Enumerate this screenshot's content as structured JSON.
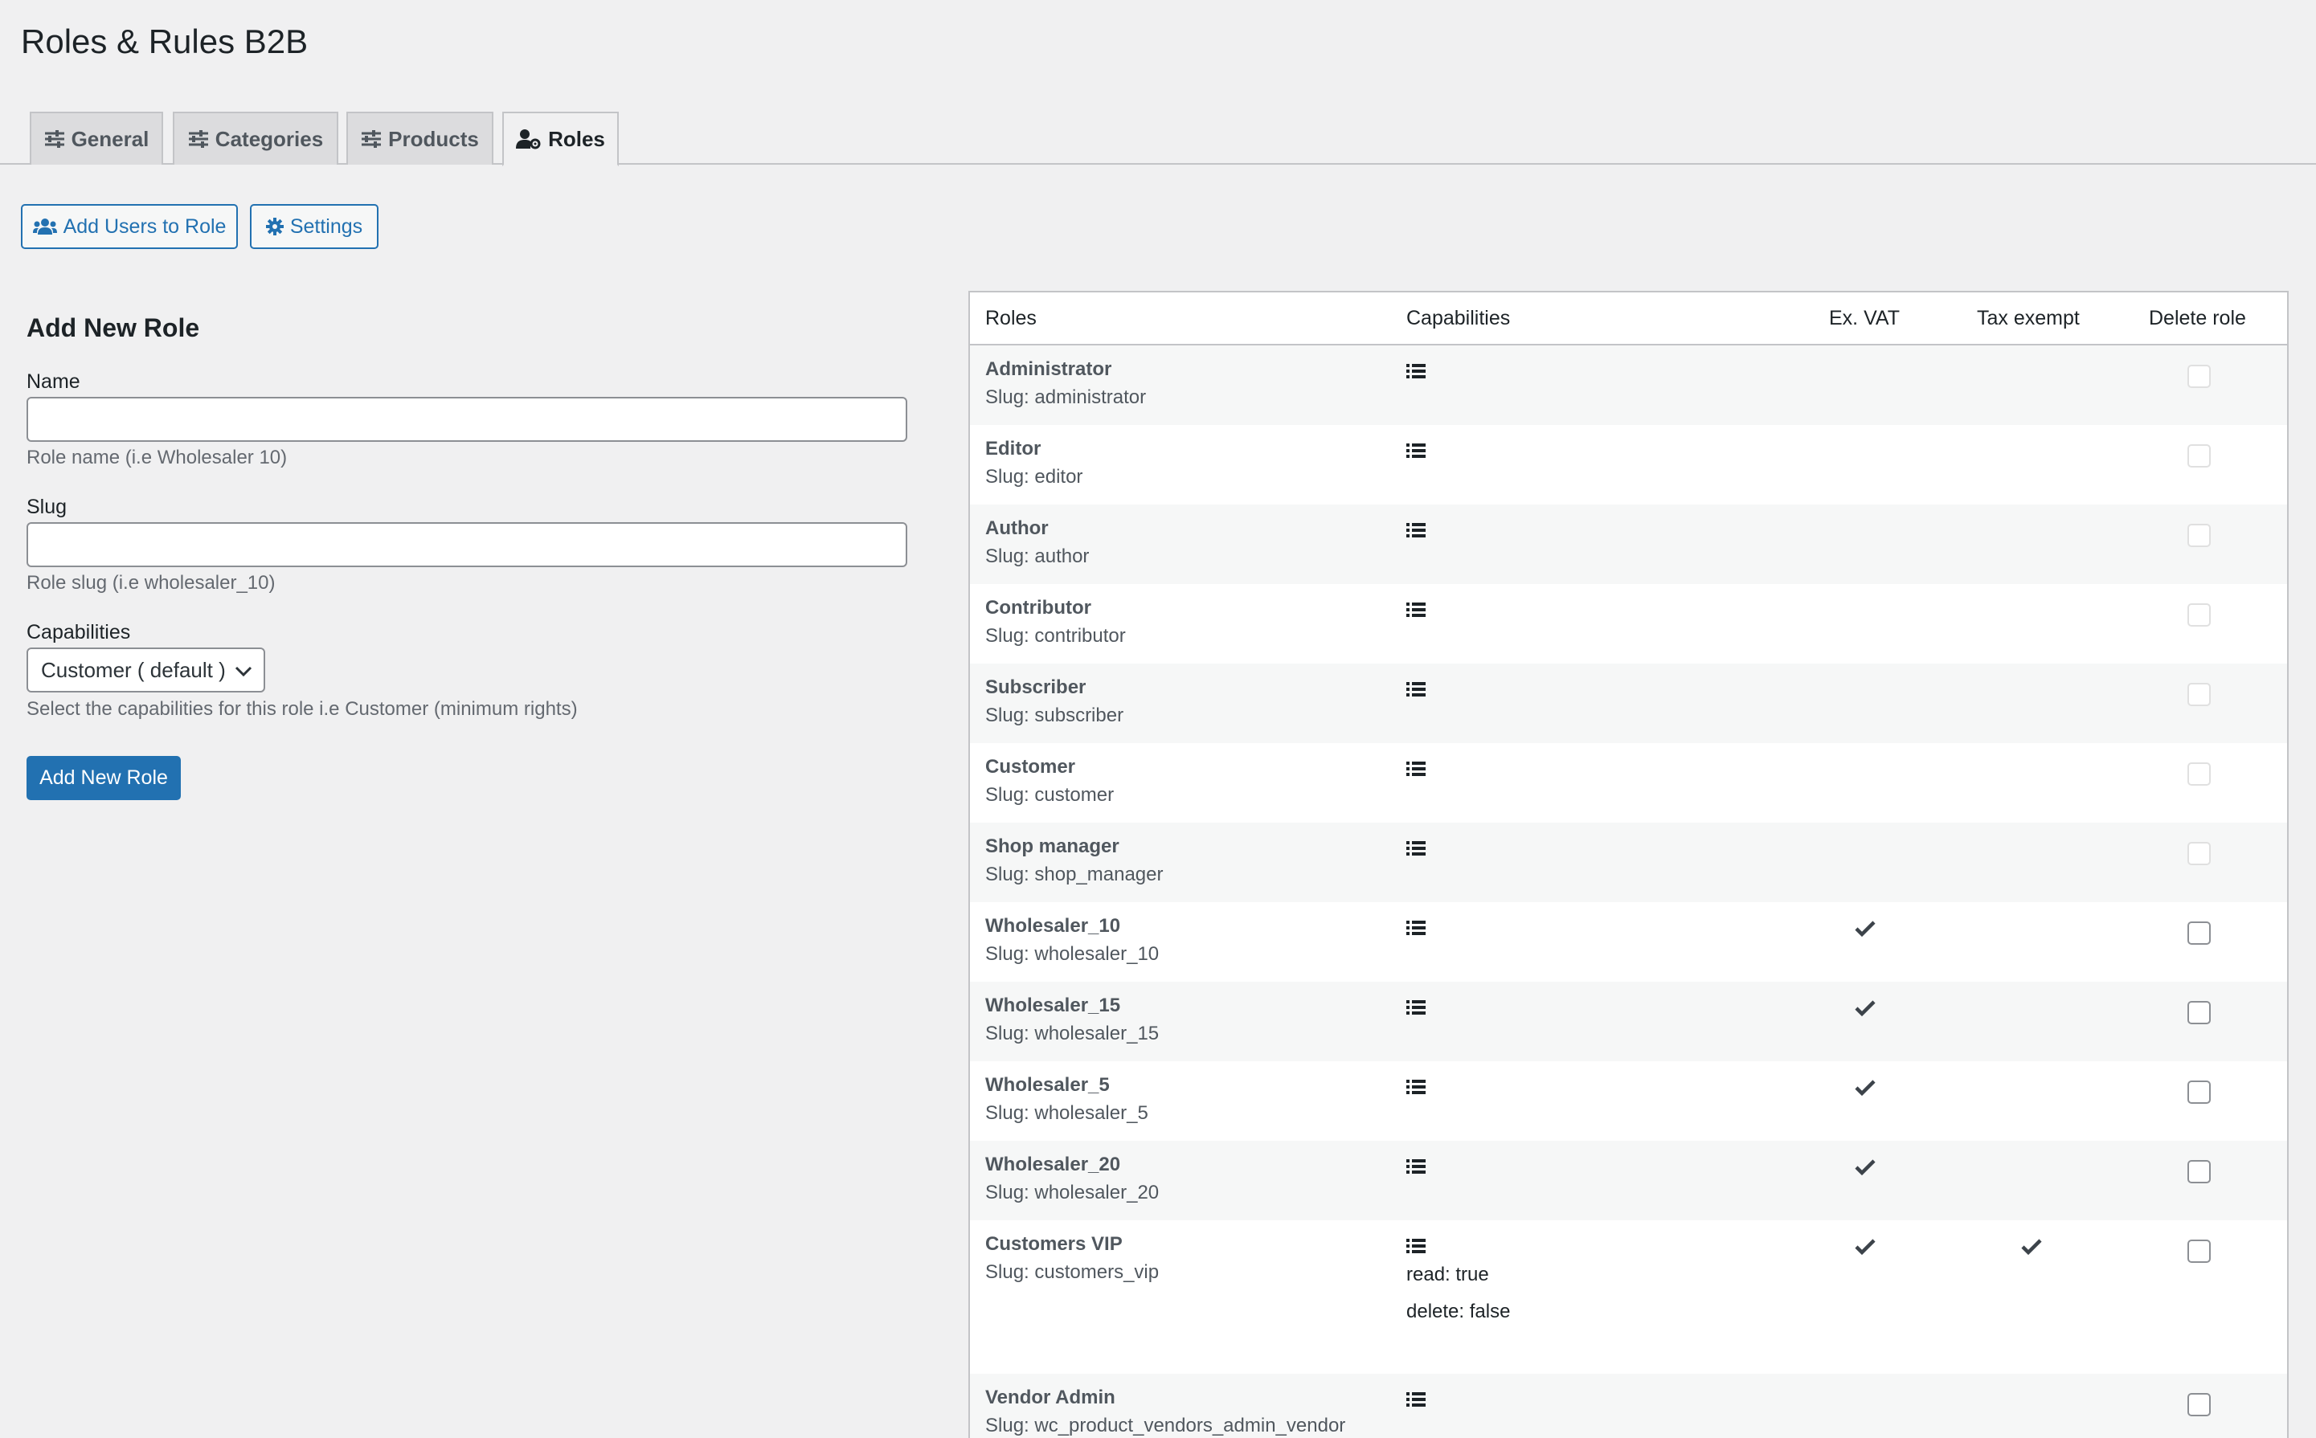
{
  "page": {
    "title": "Roles & Rules B2B"
  },
  "tabs": [
    {
      "label": "General",
      "icon": "sliders-icon"
    },
    {
      "label": "Categories",
      "icon": "sliders-icon"
    },
    {
      "label": "Products",
      "icon": "sliders-icon"
    },
    {
      "label": "Roles",
      "icon": "user-gear-icon",
      "active": true
    }
  ],
  "actions": {
    "add_users_label": "Add Users to Role",
    "settings_label": "Settings"
  },
  "form": {
    "title": "Add New Role",
    "name_label": "Name",
    "name_value": "",
    "name_help": "Role name (i.e Wholesaler 10)",
    "slug_label": "Slug",
    "slug_value": "",
    "slug_help": "Role slug (i.e wholesaler_10)",
    "capabilities_label": "Capabilities",
    "capabilities_selected": "Customer ( default )",
    "capabilities_help": "Select the capabilities for this role i.e Customer (minimum rights)",
    "submit_label": "Add New Role"
  },
  "table": {
    "headers": {
      "roles": "Roles",
      "capabilities": "Capabilities",
      "ex_vat": "Ex. VAT",
      "tax_exempt": "Tax exempt",
      "delete_role": "Delete role"
    },
    "rows": [
      {
        "name": "Administrator",
        "slug": "Slug: administrator",
        "ex_vat": false,
        "tax_exempt": false,
        "deletable": false,
        "caps": []
      },
      {
        "name": "Editor",
        "slug": "Slug: editor",
        "ex_vat": false,
        "tax_exempt": false,
        "deletable": false,
        "caps": []
      },
      {
        "name": "Author",
        "slug": "Slug: author",
        "ex_vat": false,
        "tax_exempt": false,
        "deletable": false,
        "caps": []
      },
      {
        "name": "Contributor",
        "slug": "Slug: contributor",
        "ex_vat": false,
        "tax_exempt": false,
        "deletable": false,
        "caps": []
      },
      {
        "name": "Subscriber",
        "slug": "Slug: subscriber",
        "ex_vat": false,
        "tax_exempt": false,
        "deletable": false,
        "caps": []
      },
      {
        "name": "Customer",
        "slug": "Slug: customer",
        "ex_vat": false,
        "tax_exempt": false,
        "deletable": false,
        "caps": []
      },
      {
        "name": "Shop manager",
        "slug": "Slug: shop_manager",
        "ex_vat": false,
        "tax_exempt": false,
        "deletable": false,
        "caps": []
      },
      {
        "name": "Wholesaler_10",
        "slug": "Slug: wholesaler_10",
        "ex_vat": true,
        "tax_exempt": false,
        "deletable": true,
        "caps": []
      },
      {
        "name": "Wholesaler_15",
        "slug": "Slug: wholesaler_15",
        "ex_vat": true,
        "tax_exempt": false,
        "deletable": true,
        "caps": []
      },
      {
        "name": "Wholesaler_5",
        "slug": "Slug: wholesaler_5",
        "ex_vat": true,
        "tax_exempt": false,
        "deletable": true,
        "caps": []
      },
      {
        "name": "Wholesaler_20",
        "slug": "Slug: wholesaler_20",
        "ex_vat": true,
        "tax_exempt": false,
        "deletable": true,
        "caps": []
      },
      {
        "name": "Customers VIP",
        "slug": "Slug: customers_vip",
        "ex_vat": true,
        "tax_exempt": true,
        "deletable": true,
        "caps": [
          "read: true",
          "delete: false"
        ]
      },
      {
        "name": "Vendor Admin",
        "slug": "Slug: wc_product_vendors_admin_vendor",
        "ex_vat": false,
        "tax_exempt": false,
        "deletable": true,
        "caps": []
      }
    ]
  }
}
